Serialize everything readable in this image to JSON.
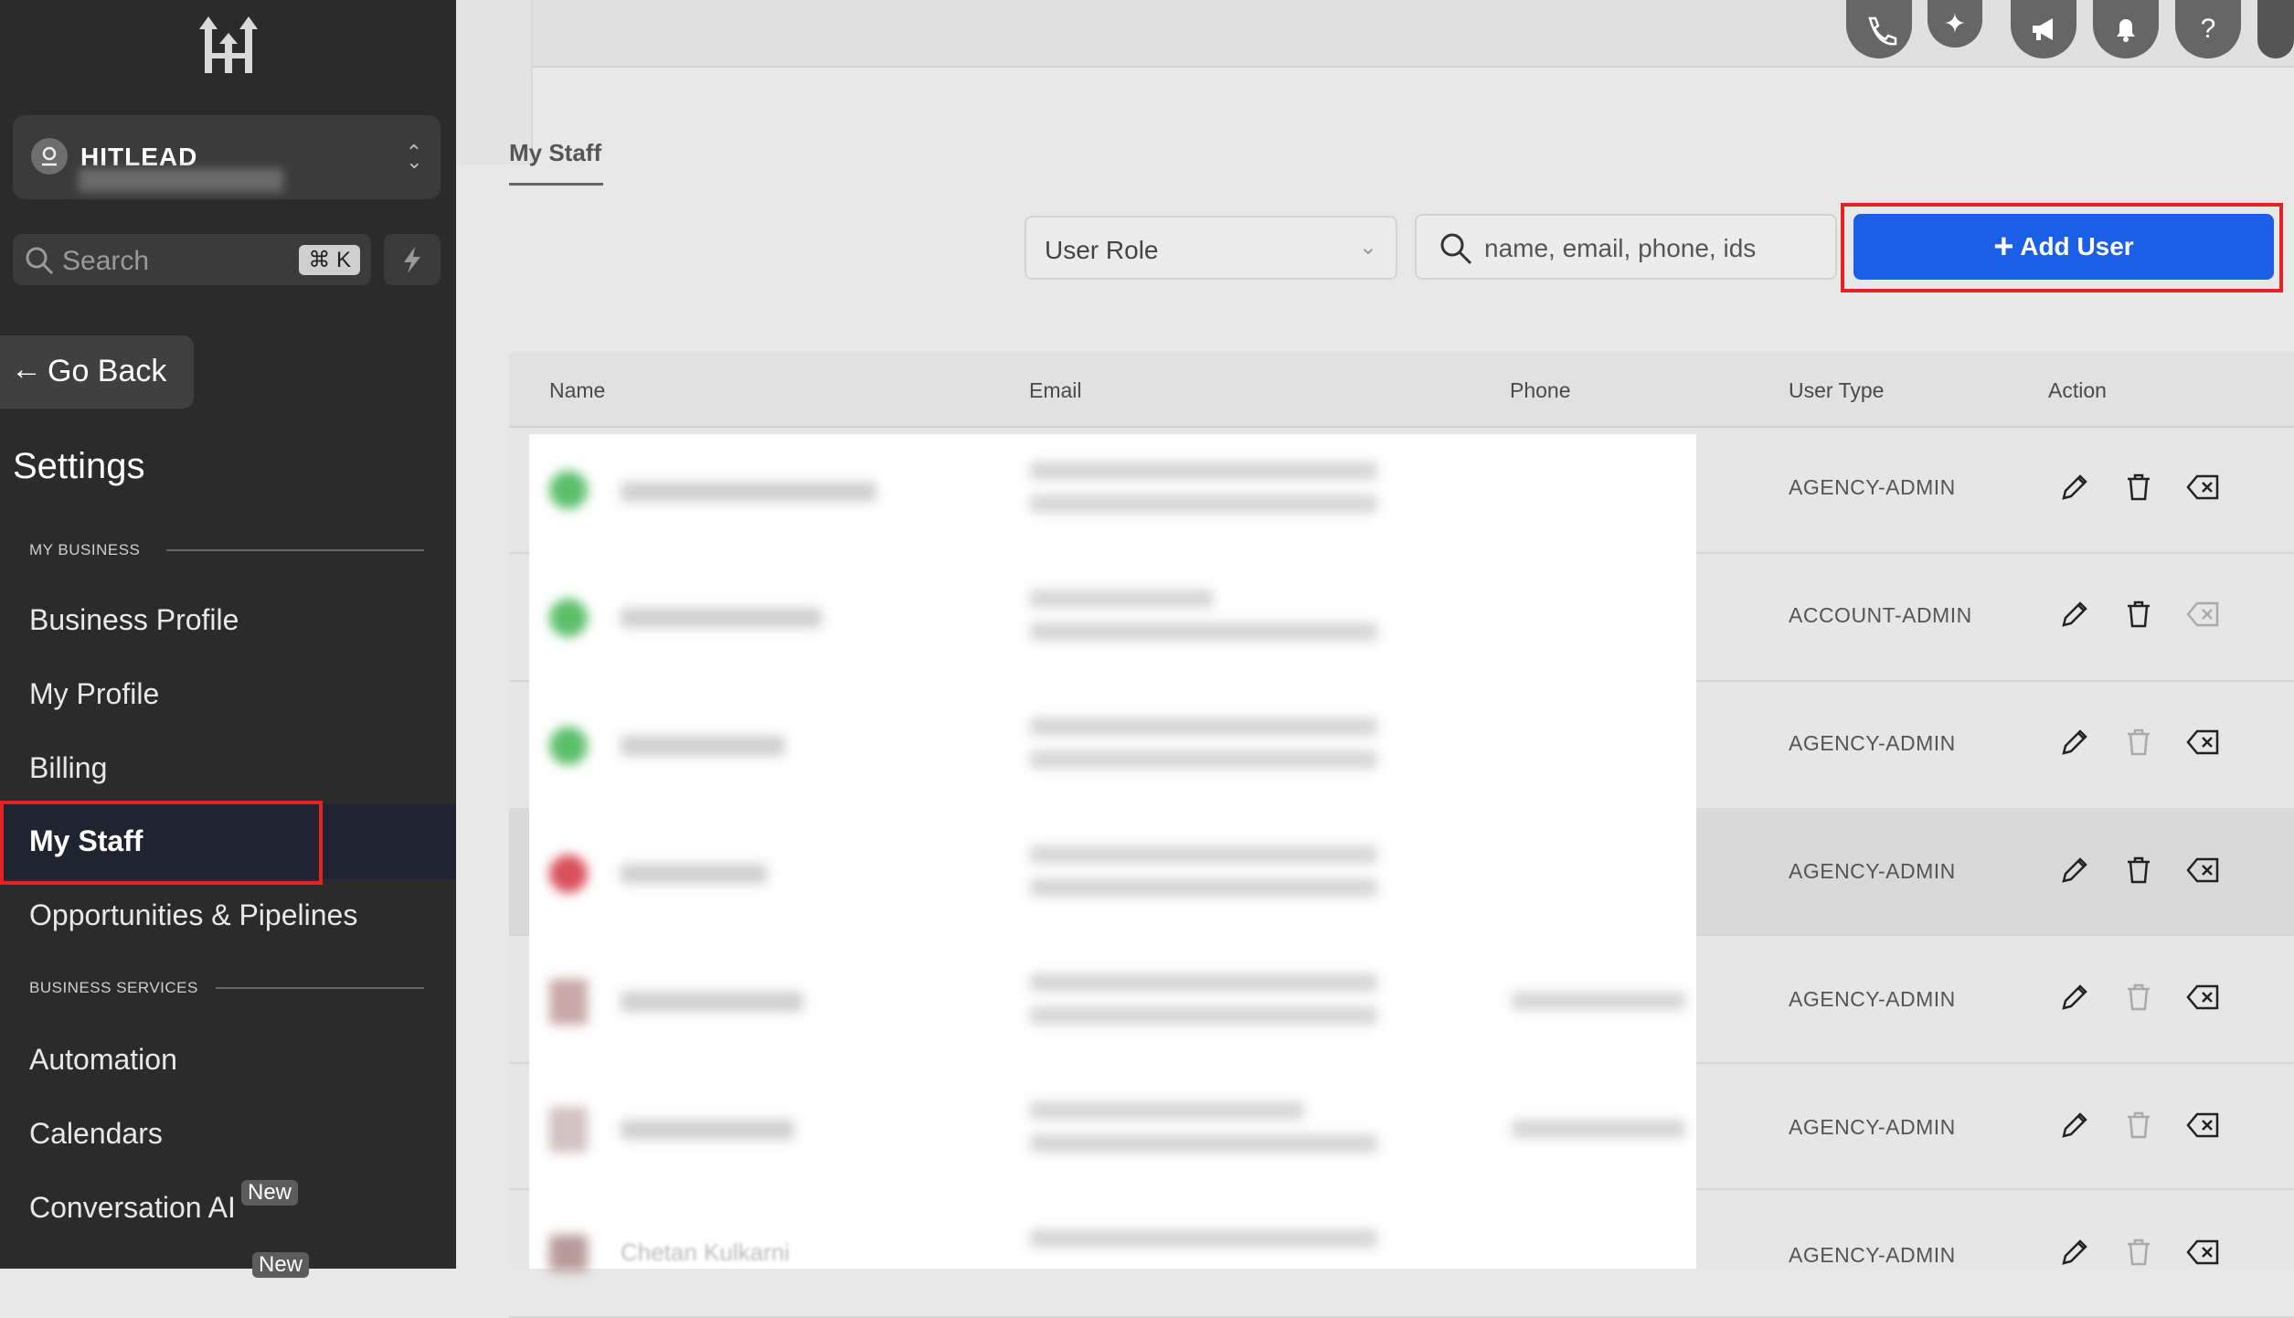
{
  "sidebar": {
    "location_name": "HITLEAD",
    "search_placeholder": "Search",
    "search_shortcut": "⌘ K",
    "go_back": "Go Back",
    "settings_title": "Settings",
    "section_my_business": "MY BUSINESS",
    "nav_business": [
      "Business Profile",
      "My Profile",
      "Billing",
      "My Staff",
      "Opportunities & Pipelines"
    ],
    "section_business_services": "BUSINESS SERVICES",
    "nav_services": [
      "Automation",
      "Calendars",
      "Conversation AI"
    ],
    "badge_new": "New",
    "badge_new_2": "New"
  },
  "page": {
    "tab_label": "My Staff",
    "role_filter": "User Role",
    "search_placeholder": "name, email, phone, ids",
    "add_user_label": "Add User"
  },
  "table": {
    "columns": [
      "Name",
      "Email",
      "Phone",
      "User Type",
      "Action"
    ],
    "rows": [
      {
        "user_type": "AGENCY-ADMIN"
      },
      {
        "user_type": "ACCOUNT-ADMIN"
      },
      {
        "user_type": "AGENCY-ADMIN"
      },
      {
        "user_type": "AGENCY-ADMIN"
      },
      {
        "user_type": "AGENCY-ADMIN"
      },
      {
        "user_type": "AGENCY-ADMIN"
      },
      {
        "user_type": "AGENCY-ADMIN",
        "name": "Chetan Kulkarni"
      }
    ]
  },
  "colors": {
    "sidebar_bg": "#2b2b2b",
    "accent": "#1a5fe6",
    "highlight": "#e32222"
  }
}
